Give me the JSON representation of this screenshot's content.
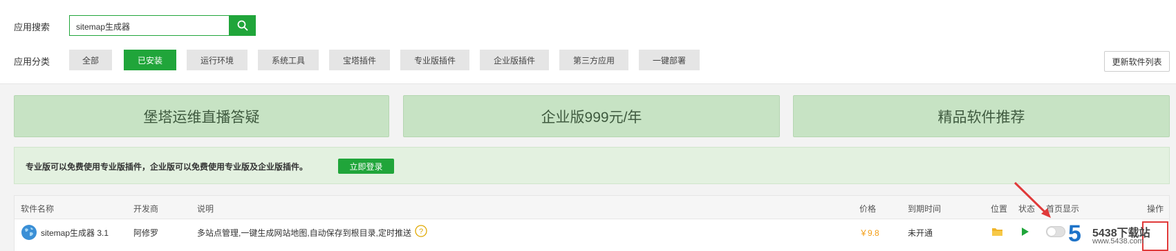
{
  "search": {
    "label": "应用搜索",
    "value": "sitemap生成器"
  },
  "category": {
    "label": "应用分类",
    "items": [
      "全部",
      "已安装",
      "运行环境",
      "系统工具",
      "宝塔插件",
      "专业版插件",
      "企业版插件",
      "第三方应用",
      "一键部署"
    ],
    "active_index": 1,
    "refresh_label": "更新软件列表"
  },
  "banners": [
    "堡塔运维直播答疑",
    "企业版999元/年",
    "精品软件推荐"
  ],
  "notice": {
    "text": "专业版可以免费使用专业版插件，企业版可以免费使用专业版及企业版插件。",
    "button": "立即登录"
  },
  "table": {
    "headers": [
      "软件名称",
      "开发商",
      "说明",
      "价格",
      "到期时间",
      "位置",
      "状态",
      "首页显示",
      "操作"
    ],
    "rows": [
      {
        "name": "sitemap生成器 3.1",
        "developer": "阿修罗",
        "description": "多站点管理,一键生成网站地图,自动保存到根目录,定时推送",
        "price": "￥9.8",
        "expiry": "未开通",
        "home_display": false
      }
    ]
  },
  "watermark": {
    "digit": "5",
    "text": "5438下载站",
    "url": "www.5438.com"
  },
  "colors": {
    "accent": "#20a53a",
    "banner": "#c7e3c4",
    "price": "#f39c12",
    "annotation": "#e03a3a"
  }
}
